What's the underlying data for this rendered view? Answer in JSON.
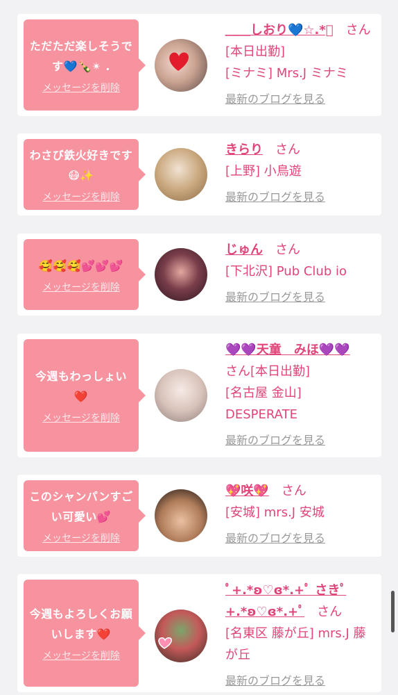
{
  "cards": [
    {
      "message": "ただただ楽しそうです💙🍾✴︎ .",
      "delete": "メッセージを削除",
      "name": "＿＿しおり💙☆.*ﾟ",
      "san": "さん[本日出勤]",
      "shop": "[ミナミ] Mrs.J ミナミ",
      "blog": "最新のブログを見る"
    },
    {
      "message": "わさび鉄火好きです😷✨",
      "delete": "メッセージを削除",
      "name": "きらり",
      "san": "さん",
      "shop": "[上野] 小鳥遊",
      "blog": "最新のブログを見る"
    },
    {
      "message": "🥰🥰🥰💕💕💕",
      "delete": "メッセージを削除",
      "name": "じゅん",
      "san": "さん",
      "shop": "[下北沢] Pub Club io",
      "blog": "最新のブログを見る"
    },
    {
      "message": "今週もわっしょい❤️",
      "delete": "メッセージを削除",
      "name": "💜💜天童　みほ💜💜",
      "san": "さん[本日出勤]",
      "shop": "[名古屋 金山] DESPERATE",
      "blog": "最新のブログを見る"
    },
    {
      "message": "このシャンパンすごい可愛い💕",
      "delete": "メッセージを削除",
      "name": "💖咲💖",
      "san": "さん",
      "shop": "[安城] mrs.J 安城",
      "blog": "最新のブログを見る"
    },
    {
      "message": "今週もよろしくお願いします❤️",
      "delete": "メッセージを削除",
      "name": "ﾟ+.*ʚ♡ɞ*.+ﾟ さきﾟ+.*ʚ♡ɞ*.+ﾟ",
      "san": "さん",
      "shop": "[名東区 藤が丘] mrs.J 藤が丘",
      "blog": "最新のブログを見る"
    }
  ]
}
